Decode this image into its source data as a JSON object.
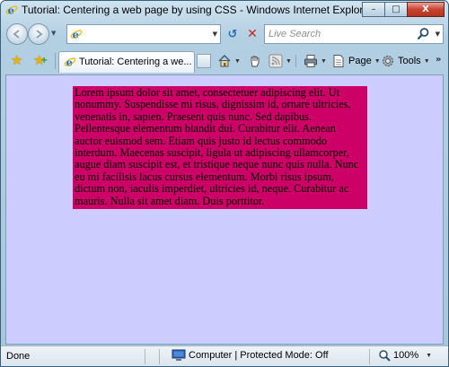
{
  "window": {
    "title": "Tutorial: Centering a web page by using CSS - Windows Internet Explorer",
    "caption_minimize": "–",
    "caption_maximize": "□",
    "caption_close": "X"
  },
  "nav": {
    "back_icon": "back-arrow-icon",
    "forward_icon": "forward-arrow-icon",
    "address_value": "",
    "search_placeholder": "Live Search"
  },
  "tabs": [
    {
      "label": "Tutorial: Centering a we...",
      "active": true
    }
  ],
  "commands": {
    "page_label": "Page",
    "tools_label": "Tools"
  },
  "content": {
    "background_color": "#ccccff",
    "box_color": "#cc0066",
    "lorem_text": "Lorem ipsum dolor sit amet, consectetuer adipiscing elit. Ut nonummy. Suspendisse mi risus, dignissim id, ornare ultricies, venenatis in, sapien. Praesent quis nunc. Sed dapibus. Pellentesque elementum blandit dui. Curabitur elit. Aenean auctor euismod sem. Etiam quis justo id lectus commodo interdum. Maecenas suscipit, ligula ut adipiscing ullamcorper, augue diam suscipit est, et tristique neque nunc quis nulla. Nunc eu mi facilisis lacus cursus elementum. Morbi risus ipsum, dictum non, iaculis imperdiet, ultricies id, neque. Curabitur ac mauris. Nulla sit amet diam. Duis porttitor."
  },
  "status": {
    "done": "Done",
    "zone": "Computer | Protected Mode: Off",
    "zoom": "100%"
  }
}
